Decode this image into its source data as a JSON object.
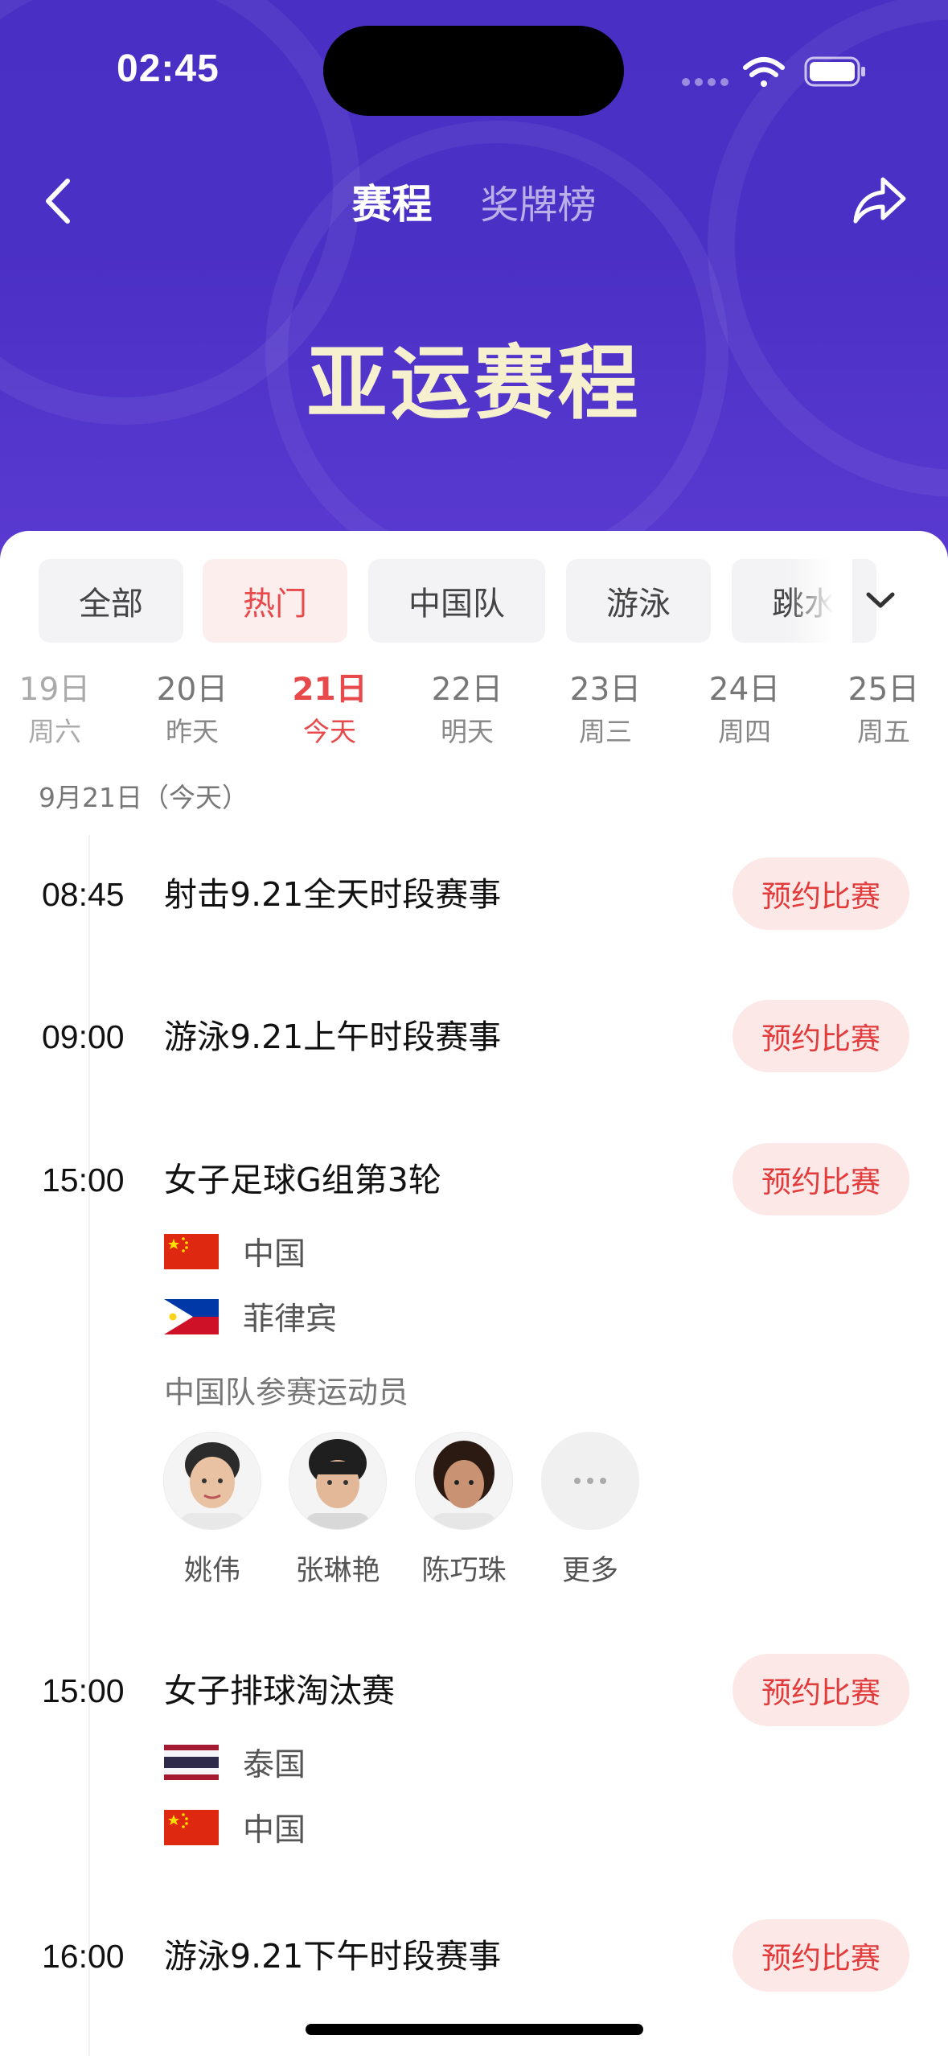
{
  "status_bar": {
    "time": "02:45"
  },
  "nav": {
    "tabs": [
      "赛程",
      "奖牌榜"
    ]
  },
  "hero": {
    "title": "亚运赛程"
  },
  "filters": [
    "全部",
    "热门",
    "中国队",
    "游泳",
    "跳水"
  ],
  "active_filter": "热门",
  "dates": [
    {
      "day": "19日",
      "weekday": "周六"
    },
    {
      "day": "20日",
      "weekday": "昨天"
    },
    {
      "day": "21日",
      "weekday": "今天"
    },
    {
      "day": "22日",
      "weekday": "明天"
    },
    {
      "day": "23日",
      "weekday": "周三"
    },
    {
      "day": "24日",
      "weekday": "周四"
    },
    {
      "day": "25日",
      "weekday": "周五"
    }
  ],
  "active_date": "21日",
  "day_label": "9月21日（今天）",
  "book_label": "预约比赛",
  "events": [
    {
      "time": "08:45",
      "title": "射击9.21全天时段赛事"
    },
    {
      "time": "09:00",
      "title": "游泳9.21上午时段赛事"
    },
    {
      "time": "15:00",
      "title": "女子足球G组第3轮",
      "teams": [
        {
          "name": "中国",
          "flag": "china-flag"
        },
        {
          "name": "菲律宾",
          "flag": "philippines-flag"
        }
      ],
      "athletes_label": "中国队参赛运动员",
      "athletes": [
        "姚伟",
        "张琳艳",
        "陈巧珠"
      ],
      "more_label": "更多"
    },
    {
      "time": "15:00",
      "title": "女子排球淘汰赛",
      "teams": [
        {
          "name": "泰国",
          "flag": "thailand-flag"
        },
        {
          "name": "中国",
          "flag": "china-flag"
        }
      ]
    },
    {
      "time": "16:00",
      "title": "游泳9.21下午时段赛事"
    }
  ],
  "colors": {
    "hero_bg": "#4b30c6",
    "accent_red": "#e8494a",
    "button_bg": "#fde8e8",
    "hero_title": "#f7f0cf"
  }
}
